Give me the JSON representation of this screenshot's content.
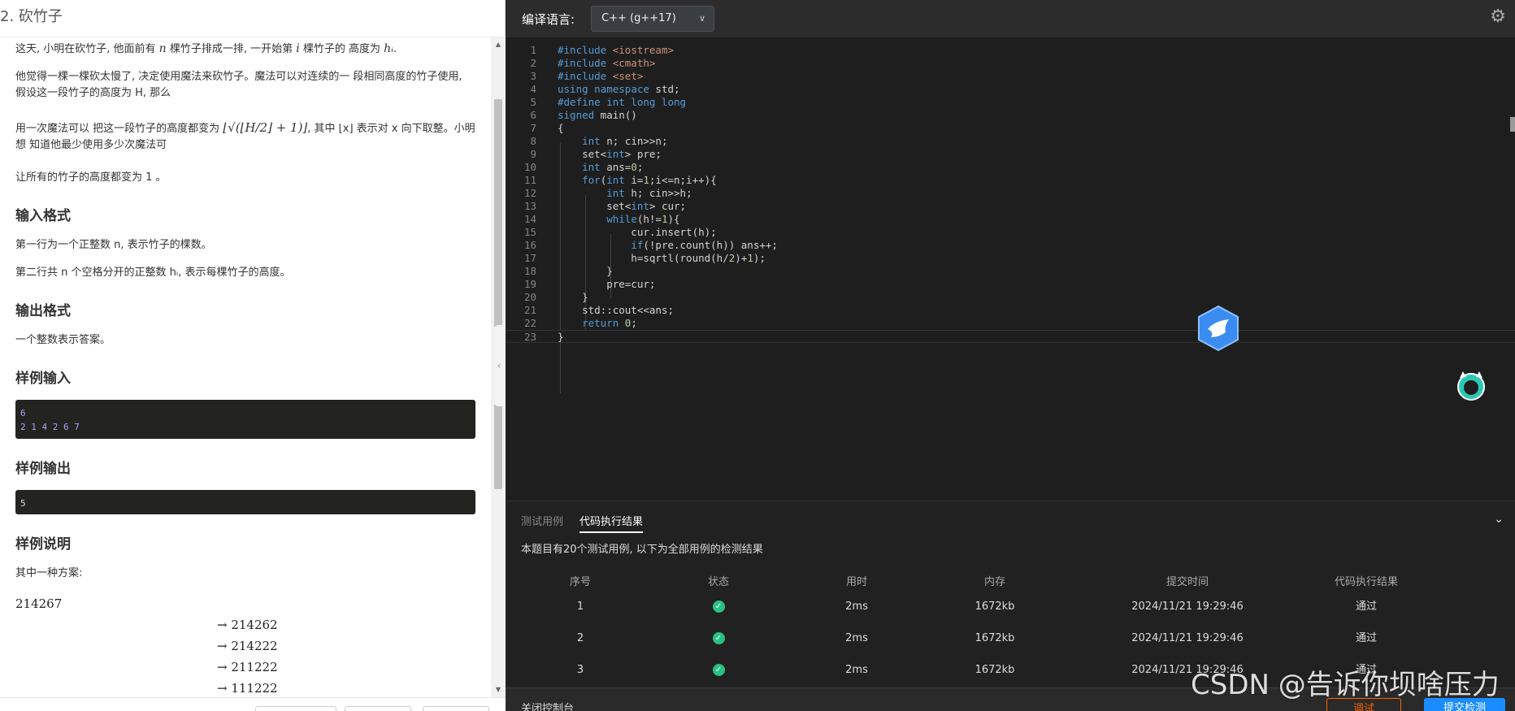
{
  "problem": {
    "title": "2. 砍竹子",
    "intro": [
      "这天, 小明在砍竹子, 他面前有 ",
      "n",
      " 棵竹子排成一排, 一开始第 ",
      "i",
      " 棵竹子的 高度为 ",
      "hᵢ",
      "."
    ],
    "p2": "他觉得一棵一棵砍太慢了, 决定使用魔法来砍竹子。魔法可以对连续的一 段相同高度的竹子使用, 假设这一段竹子的高度为 H, 那么",
    "p3a": "用一次魔法可以 把这一段竹子的高度都变为",
    "p3formula": "⌊√(⌊H/2⌋ + 1)⌋",
    "p3b": ", 其中 ⌊x⌋ 表示对 x 向下取整。小明想 知道他最少使用多少次魔法可",
    "p4": "让所有的竹子的高度都变为 1 。",
    "input_heading": "输入格式",
    "input_p1": "第一行为一个正整数 n, 表示竹子的棵数。",
    "input_p2": "第二行共 n 个空格分开的正整数 hᵢ, 表示每棵竹子的高度。",
    "output_heading": "输出格式",
    "output_p": "一个整数表示答案。",
    "sample_in_heading": "样例输入",
    "sample_in": [
      "6",
      "2 1 4 2 6 7"
    ],
    "sample_out_heading": "样例输出",
    "sample_out": [
      "5"
    ],
    "explain_heading": "样例说明",
    "explain_p": "其中一种方案:",
    "math": [
      "214267",
      "→ 214262",
      "→ 214222",
      "→ 211222",
      "→ 111222"
    ]
  },
  "editor": {
    "lang_label": "编译语言:",
    "lang_value": "C++ (g++17)",
    "lines": [
      "#include <iostream>",
      "#include <cmath>",
      "#include <set>",
      "using namespace std;",
      "#define int long long",
      "signed main()",
      "{",
      "    int n; cin>>n;",
      "    set<int> pre;",
      "    int ans=0;",
      "    for(int i=1;i<=n;i++){",
      "        int h; cin>>h;",
      "        set<int> cur;",
      "        while(h!=1){",
      "            cur.insert(h);",
      "            if(!pre.count(h)) ans++;",
      "            h=sqrtl(round(h/2)+1);",
      "        }",
      "        pre=cur;",
      "    }",
      "    std::cout<<ans;",
      "    return 0;",
      "}"
    ]
  },
  "result": {
    "tab_cases": "测试用例",
    "tab_result": "代码执行结果",
    "summary": "本题目有20个测试用例, 以下为全部用例的检测结果",
    "headers": [
      "序号",
      "状态",
      "用时",
      "内存",
      "提交时间",
      "代码执行结果"
    ],
    "rows": [
      {
        "id": "1",
        "time": "2ms",
        "mem": "1672kb",
        "submitted": "2024/11/21 19:29:46",
        "result": "通过"
      },
      {
        "id": "2",
        "time": "2ms",
        "mem": "1672kb",
        "submitted": "2024/11/21 19:29:46",
        "result": "通过"
      },
      {
        "id": "3",
        "time": "2ms",
        "mem": "1672kb",
        "submitted": "2024/11/21 19:29:46",
        "result": "通过"
      }
    ],
    "console_label": "关闭控制台",
    "run_label": "调试",
    "submit_label": "提交检测"
  },
  "watermark": "CSDN @告诉你坝啥压力",
  "colors": {
    "accent": "#1a8cff",
    "success": "#2ac280",
    "run": "#ff6600"
  }
}
